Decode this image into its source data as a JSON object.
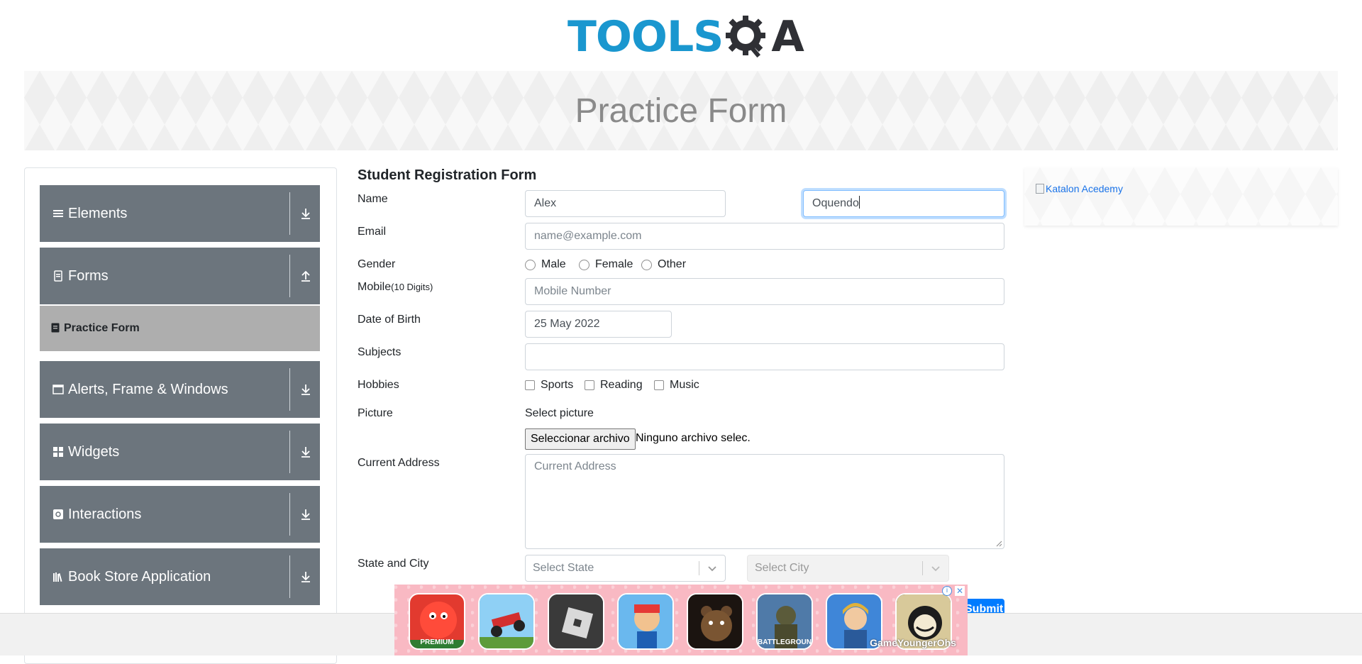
{
  "header": {
    "logo_left": "TOOLS",
    "logo_right": "A",
    "banner_title": "Practice Form"
  },
  "sidebar": {
    "groups": [
      {
        "label": "Elements",
        "icon": "hamburger-icon",
        "arrow": "download-icon"
      },
      {
        "label": "Forms",
        "icon": "document-icon",
        "arrow": "upload-icon"
      },
      {
        "label": "Alerts, Frame & Windows",
        "icon": "window-icon",
        "arrow": "download-icon"
      },
      {
        "label": "Widgets",
        "icon": "grid-icon",
        "arrow": "download-icon"
      },
      {
        "label": "Interactions",
        "icon": "refresh-icon",
        "arrow": "download-icon"
      },
      {
        "label": "Book Store Application",
        "icon": "books-icon",
        "arrow": "download-icon"
      }
    ],
    "active_item": "Practice Form"
  },
  "form": {
    "title": "Student Registration Form",
    "labels": {
      "name": "Name",
      "email": "Email",
      "gender": "Gender",
      "mobile": "Mobile",
      "mobile_hint": "(10 Digits)",
      "dob": "Date of Birth",
      "subjects": "Subjects",
      "hobbies": "Hobbies",
      "picture": "Picture",
      "address": "Current Address",
      "state_city": "State and City"
    },
    "first_name": "Alex",
    "last_name": "Oquendo",
    "email_placeholder": "name@example.com",
    "genders": [
      "Male",
      "Female",
      "Other"
    ],
    "mobile_placeholder": "Mobile Number",
    "dob_value": "25 May 2022",
    "subjects_value": "",
    "hobbies": [
      "Sports",
      "Reading",
      "Music"
    ],
    "picture_prompt": "Select picture",
    "file_button": "Seleccionar archivo",
    "file_status": "Ninguno archivo selec.",
    "address_placeholder": "Current Address",
    "state_placeholder": "Select State",
    "city_placeholder": "Select City",
    "submit_label": "Submit"
  },
  "side_ad": {
    "alt_text": "Katalon Acedemy"
  },
  "bottom_ad": {
    "tiles": [
      {
        "label": "PREMIUM",
        "color": "#e23a2f"
      },
      {
        "label": "",
        "color": "#4fa3e0"
      },
      {
        "label": "",
        "color": "#2b2b2b"
      },
      {
        "label": "",
        "color": "#3b8fd6"
      },
      {
        "label": "",
        "color": "#3a2a1c"
      },
      {
        "label": "BATTLEGROUNDS",
        "color": "#2c4a6e"
      },
      {
        "label": "",
        "color": "#4a8ad6"
      },
      {
        "label": "",
        "color": "#1c1c1c"
      }
    ],
    "brand": "GameYoungerOhs"
  },
  "colors": {
    "accent": "#1a97cf",
    "sidebar_group": "#6c757d",
    "sidebar_active": "#aeaeae",
    "primary_button": "#007bff"
  }
}
